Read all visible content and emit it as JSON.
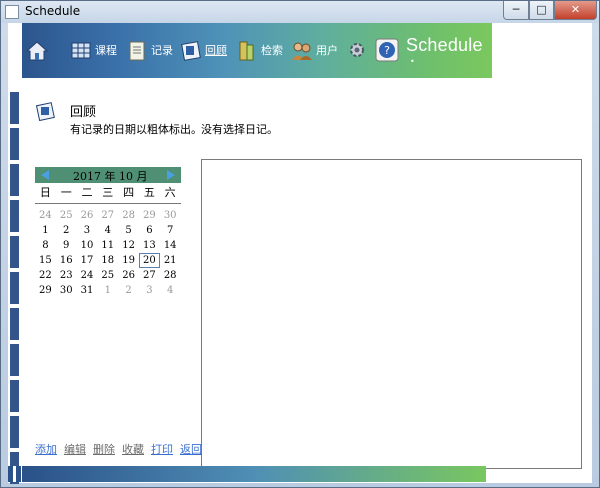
{
  "window": {
    "title": "Schedule",
    "minimize_label": "─",
    "maximize_label": "□",
    "close_label": "✕"
  },
  "toolbar": {
    "items": [
      {
        "name": "home",
        "label": "",
        "icon": "home-icon"
      },
      {
        "name": "course",
        "label": "课程",
        "icon": "course-icon"
      },
      {
        "name": "record",
        "label": "记录",
        "icon": "record-icon"
      },
      {
        "name": "review",
        "label": "回顾",
        "icon": "review-icon",
        "active": true
      },
      {
        "name": "search",
        "label": "检索",
        "icon": "search-icon"
      },
      {
        "name": "user",
        "label": "用户",
        "icon": "user-icon"
      },
      {
        "name": "settings",
        "label": "",
        "icon": "gear-icon"
      },
      {
        "name": "help",
        "label": "",
        "icon": "help-icon"
      }
    ],
    "brand": "Schedule",
    "brand_mark": "•"
  },
  "panel": {
    "title": "回顾",
    "subtitle": "有记录的日期以粗体标出。",
    "icon": "review-icon"
  },
  "calendar": {
    "title": "2017 年 10 月",
    "weekdays": [
      "日",
      "一",
      "二",
      "三",
      "四",
      "五",
      "六"
    ],
    "weeks": [
      [
        "24",
        "25",
        "26",
        "27",
        "28",
        "29",
        "30"
      ],
      [
        "1",
        "2",
        "3",
        "4",
        "5",
        "6",
        "7"
      ],
      [
        "8",
        "9",
        "10",
        "11",
        "12",
        "13",
        "14"
      ],
      [
        "15",
        "16",
        "17",
        "18",
        "19",
        "20",
        "21"
      ],
      [
        "22",
        "23",
        "24",
        "25",
        "26",
        "27",
        "28"
      ],
      [
        "29",
        "30",
        "31",
        "1",
        "2",
        "3",
        "4"
      ]
    ],
    "today": "20",
    "prev_label": "◀",
    "next_label": "▶"
  },
  "diary": {
    "status": "没有选择日记。"
  },
  "actions": [
    {
      "name": "add",
      "label": "添加",
      "enabled": true
    },
    {
      "name": "edit",
      "label": "编辑",
      "enabled": false
    },
    {
      "name": "delete",
      "label": "删除",
      "enabled": false
    },
    {
      "name": "favorite",
      "label": "收藏",
      "enabled": false
    },
    {
      "name": "print",
      "label": "打印",
      "enabled": true
    },
    {
      "name": "back",
      "label": "返回",
      "enabled": true
    }
  ],
  "colors": {
    "toolbar_start": "#2a5189",
    "toolbar_end": "#7bc85e",
    "calendar_header": "#4f8f73",
    "link_enabled": "#3b6fcf",
    "link_disabled": "#6b6b6b"
  }
}
